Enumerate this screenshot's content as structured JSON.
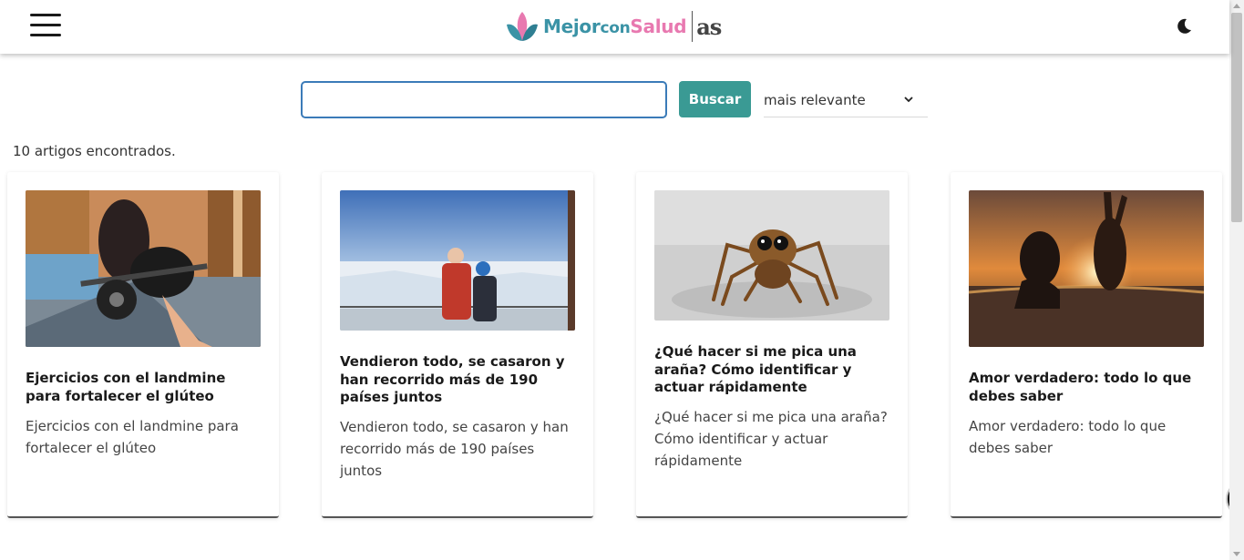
{
  "header": {
    "menu_icon": "hamburger-icon",
    "logo": {
      "part1": "Mejor",
      "part2": "con",
      "part3": "Salud",
      "partner": "as"
    },
    "theme_icon": "moon-icon"
  },
  "search": {
    "value": "",
    "placeholder": "",
    "button_label": "Buscar",
    "sort_selected": "mais relevante",
    "sort_icon": "chevron-down-icon"
  },
  "results": {
    "count_text": "10 artigos encontrados."
  },
  "cards": [
    {
      "title": "Ejercicios con el landmine para fortalecer el glúteo",
      "excerpt": "Ejercicios con el landmine para fortalecer el glúteo",
      "image": "woman-gym-landmine-photo"
    },
    {
      "title": "Vendieron todo, se casaron y han recorrido más de 190 países juntos",
      "excerpt": "Vendieron todo, se casaron y han recorrido más de 190 países juntos",
      "image": "elderly-couple-antarctica-photo"
    },
    {
      "title": "¿Qué hacer si me pica una araña? Cómo identificar y actuar rápidamente",
      "excerpt": "¿Qué hacer si me pica una araña? Cómo identificar y actuar rápidamente",
      "image": "jumping-spider-photo"
    },
    {
      "title": "Amor verdadero: todo lo que debes saber",
      "excerpt": "Amor verdadero: todo lo que debes saber",
      "image": "couple-sunset-water-photo"
    }
  ],
  "colors": {
    "brand_teal": "#3b93a6",
    "brand_pink": "#e879b0",
    "button": "#3a9a94",
    "input_border": "#3b7bb8"
  }
}
